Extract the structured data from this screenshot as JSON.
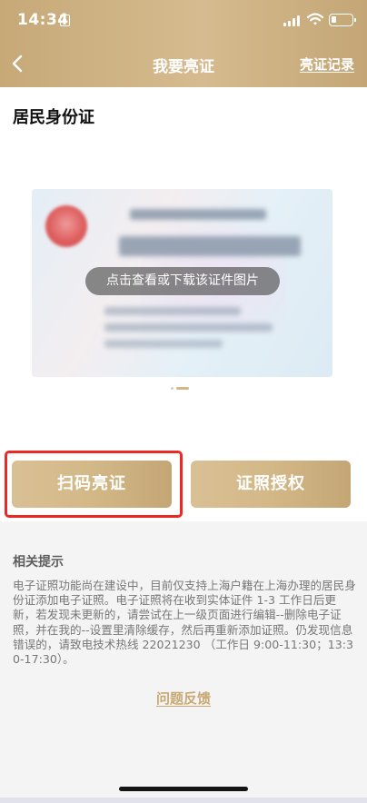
{
  "status_bar": {
    "time": "14:34",
    "icons": [
      "note-icon",
      "signal-icon",
      "wifi-icon",
      "battery-icon"
    ]
  },
  "nav": {
    "back_icon": "chevron-left-icon",
    "title": "我要亮证",
    "right_link": "亮证记录"
  },
  "card": {
    "title": "居民身份证",
    "overlay_hint": "点击查看或下载该证件图片",
    "pager_pages": 2,
    "pager_active": 2
  },
  "actions": {
    "scan_label": "扫码亮证",
    "auth_label": "证照授权"
  },
  "tips": {
    "title": "相关提示",
    "body": "电子证照功能尚在建设中，目前仅支持上海户籍在上海办理的居民身份证添加电子证照。电子证照将在收到实体证件 1-3 工作日后更新，若发现未更新的，请尝试在上一级页面进行编辑--删除电子证照，并在我的--设置里清除缓存，然后再重新添加证照。仍发现信息错误的，请致电技术热线 22021230 （工作日 9:00-11:30；13:30-17:30）。"
  },
  "feedback": {
    "label": "问题反馈"
  },
  "colors": {
    "header_gold": "#cfb385",
    "button_gold": "#d3b887",
    "highlight_red": "#ea2a22",
    "link_gold": "#c8a873"
  }
}
